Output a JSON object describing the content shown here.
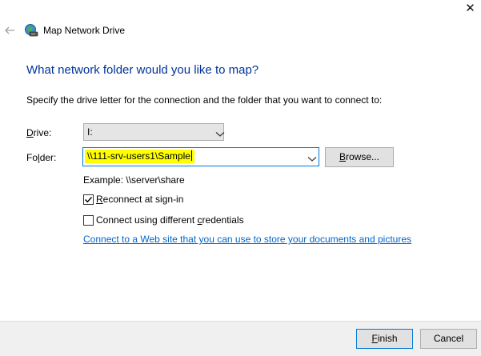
{
  "window": {
    "title": "Map Network Drive",
    "close_glyph": "✕",
    "icons": {
      "back": "back-arrow-icon",
      "app": "network-drive-icon",
      "close": "close-icon"
    }
  },
  "heading": "What network folder would you like to map?",
  "instruction": "Specify the drive letter for the connection and the folder that you want to connect to:",
  "drive": {
    "label_pre": "",
    "label_u": "D",
    "label_post": "rive:",
    "value": "I:"
  },
  "folder": {
    "label_pre": "Fo",
    "label_u": "l",
    "label_post": "der:",
    "value": "\\\\111-srv-users1\\Sample"
  },
  "browse": {
    "label_pre": "",
    "label_u": "B",
    "label_post": "rowse..."
  },
  "example": "Example: \\\\server\\share",
  "reconnect": {
    "checked": true,
    "label_pre": "",
    "label_u": "R",
    "label_post": "econnect at sign-in"
  },
  "different_credentials": {
    "checked": false,
    "label_pre": "Connect using different ",
    "label_u": "c",
    "label_post": "redentials"
  },
  "link_text": "Connect to a Web site that you can use to store your documents and pictures",
  "finish": {
    "label_pre": "",
    "label_u": "F",
    "label_post": "inish"
  },
  "cancel": {
    "label": "Cancel"
  },
  "colors": {
    "heading": "#003399",
    "link": "#0066cc",
    "highlight": "#ffff00",
    "focus_border": "#0078d7"
  }
}
